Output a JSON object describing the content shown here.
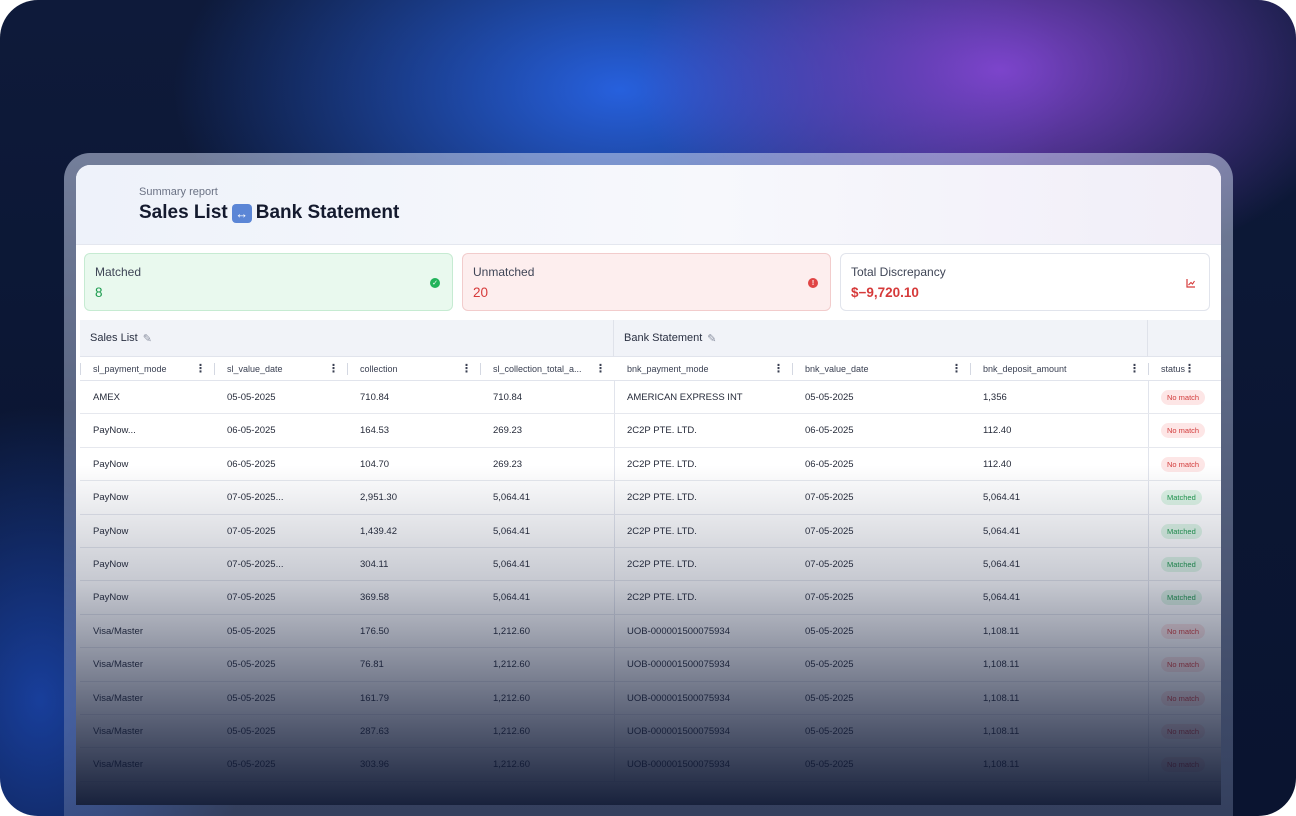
{
  "header": {
    "subtitle": "Summary report",
    "title_left": "Sales List",
    "title_icon": "↔",
    "title_right": "Bank Statement"
  },
  "cards": {
    "matched": {
      "label": "Matched",
      "value": "8",
      "icon": "check-circle-icon"
    },
    "unmatched": {
      "label": "Unmatched",
      "value": "20",
      "icon": "alert-circle-icon"
    },
    "discrepancy": {
      "label": "Total Discrepancy",
      "value": "$−9,720.10",
      "icon": "chart-icon"
    }
  },
  "groups": {
    "sales": "Sales List",
    "bank": "Bank Statement"
  },
  "columns": {
    "c1": "sl_payment_mode",
    "c2": "sl_value_date",
    "c3": "collection",
    "c4": "sl_collection_total_a...",
    "c5": "bnk_payment_mode",
    "c6": "bnk_value_date",
    "c7": "bnk_deposit_amount",
    "c8": "status"
  },
  "rows": [
    {
      "c1": "AMEX",
      "c2": "05-05-2025",
      "c3": "710.84",
      "c4": "710.84",
      "c5": "AMERICAN EXPRESS INT",
      "c6": "05-05-2025",
      "c7": "1,356",
      "status": "No match"
    },
    {
      "c1": "PayNow...",
      "c2": "06-05-2025",
      "c3": "164.53",
      "c4": "269.23",
      "c5": "2C2P PTE. LTD.",
      "c6": "06-05-2025",
      "c7": "112.40",
      "status": "No match"
    },
    {
      "c1": "PayNow",
      "c2": "06-05-2025",
      "c3": "104.70",
      "c4": "269.23",
      "c5": "2C2P PTE. LTD.",
      "c6": "06-05-2025",
      "c7": "112.40",
      "status": "No match"
    },
    {
      "c1": "PayNow",
      "c2": "07-05-2025...",
      "c3": "2,951.30",
      "c4": "5,064.41",
      "c5": "2C2P PTE. LTD.",
      "c6": "07-05-2025",
      "c7": "5,064.41",
      "status": "Matched"
    },
    {
      "c1": "PayNow",
      "c2": "07-05-2025",
      "c3": "1,439.42",
      "c4": "5,064.41",
      "c5": "2C2P PTE. LTD.",
      "c6": "07-05-2025",
      "c7": "5,064.41",
      "status": "Matched"
    },
    {
      "c1": "PayNow",
      "c2": "07-05-2025...",
      "c3": "304.11",
      "c4": "5,064.41",
      "c5": "2C2P PTE. LTD.",
      "c6": "07-05-2025",
      "c7": "5,064.41",
      "status": "Matched"
    },
    {
      "c1": "PayNow",
      "c2": "07-05-2025",
      "c3": "369.58",
      "c4": "5,064.41",
      "c5": "2C2P PTE. LTD.",
      "c6": "07-05-2025",
      "c7": "5,064.41",
      "status": "Matched"
    },
    {
      "c1": "Visa/Master",
      "c2": "05-05-2025",
      "c3": "176.50",
      "c4": "1,212.60",
      "c5": "UOB-000001500075934",
      "c6": "05-05-2025",
      "c7": "1,108.11",
      "status": "No match"
    },
    {
      "c1": "Visa/Master",
      "c2": "05-05-2025",
      "c3": "76.81",
      "c4": "1,212.60",
      "c5": "UOB-000001500075934",
      "c6": "05-05-2025",
      "c7": "1,108.11",
      "status": "No match"
    },
    {
      "c1": "Visa/Master",
      "c2": "05-05-2025",
      "c3": "161.79",
      "c4": "1,212.60",
      "c5": "UOB-000001500075934",
      "c6": "05-05-2025",
      "c7": "1,108.11",
      "status": "No match"
    },
    {
      "c1": "Visa/Master",
      "c2": "05-05-2025",
      "c3": "287.63",
      "c4": "1,212.60",
      "c5": "UOB-000001500075934",
      "c6": "05-05-2025",
      "c7": "1,108.11",
      "status": "No match"
    },
    {
      "c1": "Visa/Master",
      "c2": "05-05-2025",
      "c3": "303.96",
      "c4": "1,212.60",
      "c5": "UOB-000001500075934",
      "c6": "05-05-2025",
      "c7": "1,108.11",
      "status": "No match"
    }
  ],
  "colors": {
    "matched": "#1d9c4f",
    "unmatched": "#d63a3a",
    "accent": "#5b86d6"
  }
}
